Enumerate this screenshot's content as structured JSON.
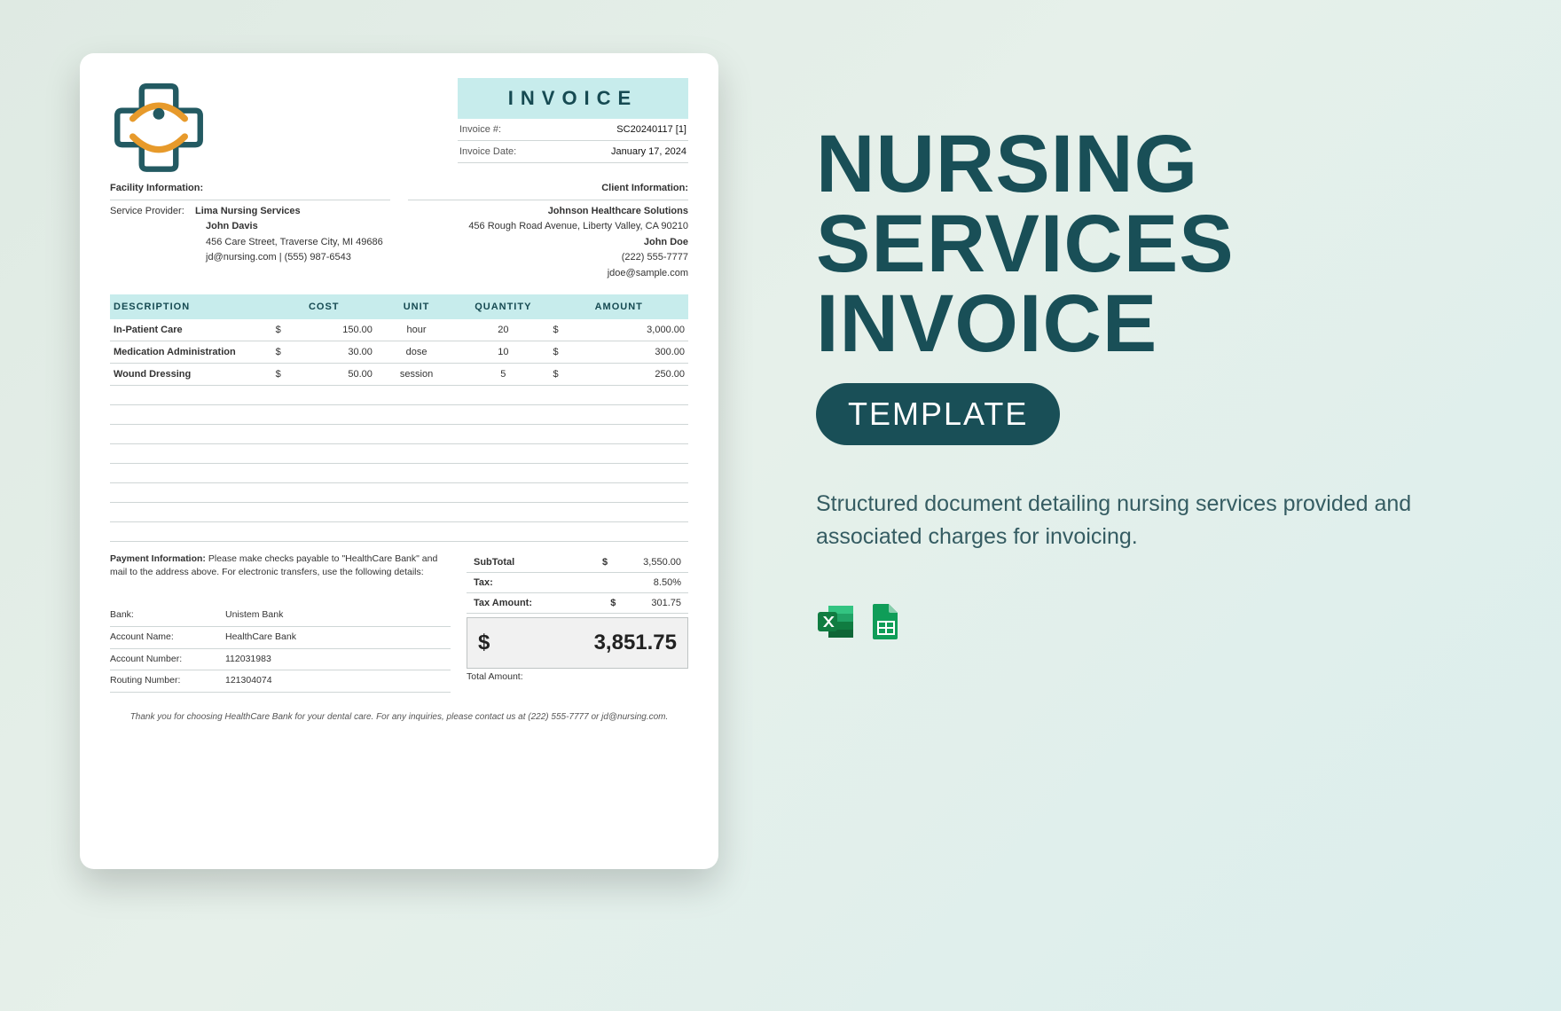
{
  "invoice": {
    "bannerTitle": "INVOICE",
    "meta": {
      "invNoLabel": "Invoice #:",
      "invNo": "SC20240117 [1]",
      "invDateLabel": "Invoice Date:",
      "invDate": "January 17, 2024"
    },
    "facility": {
      "heading": "Facility Information:",
      "providerLabel": "Service Provider:",
      "provider": "Lima Nursing Services",
      "person": "John Davis",
      "address": "456 Care Street, Traverse City, MI 49686",
      "contact": "jd@nursing.com | (555) 987-6543"
    },
    "client": {
      "heading": "Client Information:",
      "company": "Johnson Healthcare Solutions",
      "address": "456 Rough Road Avenue, Liberty Valley, CA 90210",
      "person": "John Doe",
      "phone": "(222) 555-7777",
      "email": "jdoe@sample.com"
    },
    "columns": {
      "c1": "DESCRIPTION",
      "c2": "COST",
      "c3": "UNIT",
      "c4": "QUANTITY",
      "c5": "AMOUNT"
    },
    "rows": [
      {
        "d": "In-Patient Care",
        "s": "$",
        "cost": "150.00",
        "unit": "hour",
        "qty": "20",
        "as": "$",
        "amt": "3,000.00"
      },
      {
        "d": "Medication Administration",
        "s": "$",
        "cost": "30.00",
        "unit": "dose",
        "qty": "10",
        "as": "$",
        "amt": "300.00"
      },
      {
        "d": "Wound Dressing",
        "s": "$",
        "cost": "50.00",
        "unit": "session",
        "qty": "5",
        "as": "$",
        "amt": "250.00"
      }
    ],
    "payment": {
      "label": "Payment Information:",
      "text": " Please make checks payable to \"HealthCare Bank\" and mail to the address above. For electronic transfers, use the following details:"
    },
    "bank": {
      "bankL": "Bank:",
      "bank": "Unistem Bank",
      "acctNameL": "Account Name:",
      "acctName": "HealthCare Bank",
      "acctNoL": "Account Number:",
      "acctNo": "112031983",
      "routeL": "Routing Number:",
      "route": "121304074"
    },
    "totals": {
      "subL": "SubTotal",
      "subS": "$",
      "sub": "3,550.00",
      "taxL": "Tax:",
      "tax": "8.50%",
      "taxAmtL": "Tax Amount:",
      "taxAmtS": "$",
      "taxAmt": "301.75",
      "grandS": "$",
      "grand": "3,851.75",
      "grandLabel": "Total Amount:"
    },
    "footer": "Thank you for choosing HealthCare Bank for your dental care. For any inquiries, please contact us at (222) 555-7777 or jd@nursing.com."
  },
  "promo": {
    "titleLine1": "NURSING",
    "titleLine2": "SERVICES",
    "titleLine3": "INVOICE",
    "pill": "TEMPLATE",
    "desc": "Structured document detailing nursing services provided and associated charges for invoicing."
  }
}
